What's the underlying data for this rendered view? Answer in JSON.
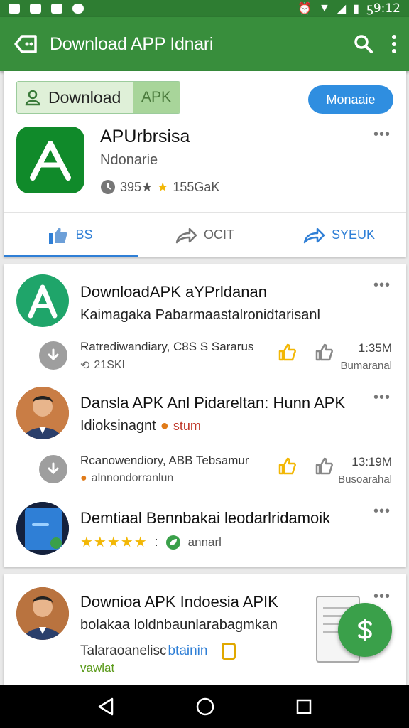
{
  "status_bar": {
    "time": "ƽ9:12"
  },
  "app_bar": {
    "title": "Download APP Idnari"
  },
  "header_card": {
    "download_label": "Download",
    "apk_label": "APK",
    "blue_button": "Monaaie",
    "app_name": "APUrbrsisa",
    "app_subtitle": "Ndonarie",
    "rating_text": "395★",
    "count_text": "155GaK",
    "tabs": [
      {
        "label": "BS"
      },
      {
        "label": "OCIT"
      },
      {
        "label": "SYEUK"
      }
    ]
  },
  "feed": [
    {
      "title": "DownloadAPK aYPrldanan",
      "subtitle": "Kaimagaka Pabarmaastalronidtarisanl",
      "meta": "Ratrediwandiary, C8S S Sararus",
      "meta_sub": "21SKI",
      "time": "1:35M",
      "time_sub": "Bumaranal"
    },
    {
      "title": "Dansla APK Anl Pidareltan: Hunn APK",
      "subtitle_a": "Idioksinagnt",
      "subtitle_b": "stum",
      "meta": "Rcanowendiory, ABB Tebsamur",
      "meta_sub": "alnnondorranlun",
      "time": "13:19M",
      "time_sub": "Busoarahal"
    },
    {
      "title": "Demtiaal Bennbakai leodarlridamoik",
      "stars": "★★★★★",
      "sep": ":",
      "tag": "annarl"
    }
  ],
  "card3": {
    "title": "Downioa APK Indoesia APIK",
    "subtitle": "bolakaa loldnbaunlarabagmkan",
    "line3_a": "Talaraoanelisc",
    "line3_b": "btainin",
    "line4": "vawlat"
  },
  "colors": {
    "primary": "#388e3c",
    "accent_blue": "#2f8ee0",
    "star": "#f2b705"
  }
}
